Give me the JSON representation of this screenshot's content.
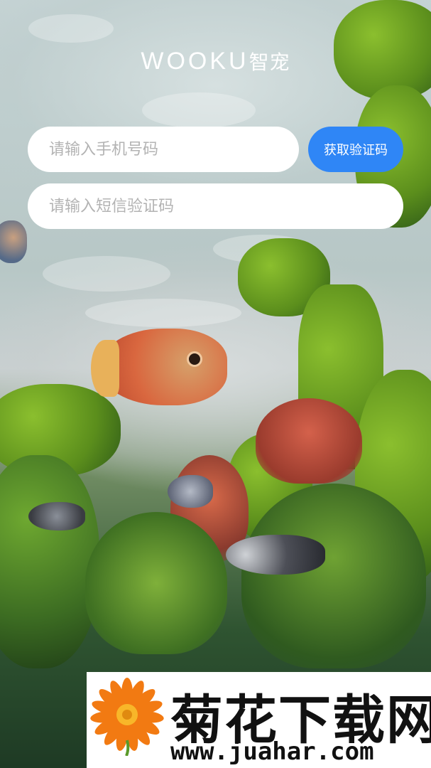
{
  "header": {
    "brand": "WOOKU",
    "brand_cn": "智宠"
  },
  "login": {
    "phone_placeholder": "请输入手机号码",
    "code_placeholder": "请输入短信验证码",
    "get_code_label": "获取验证码",
    "accent_color": "#2f86f6"
  },
  "watermark": {
    "title": "菊花下载网",
    "url": "www.juahar.com"
  }
}
